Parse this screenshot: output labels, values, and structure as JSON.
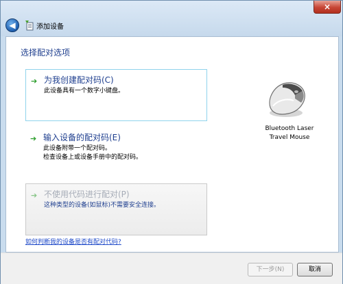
{
  "window": {
    "title": "添加设备",
    "close_label": "×"
  },
  "main": {
    "heading": "选择配对选项",
    "options": [
      {
        "title": "为我创建配对码(C)",
        "desc_lines": [
          "此设备具有一个数字小键盘。"
        ],
        "enabled": true
      },
      {
        "title": "输入设备的配对码(E)",
        "desc_lines": [
          "此设备附带一个配对码。",
          "检查设备上或设备手册中的配对码。"
        ],
        "enabled": true
      },
      {
        "title": "不使用代码进行配对(P)",
        "desc_lines": [
          "这种类型的设备(如鼠标)不需要安全连接。"
        ],
        "enabled": false
      }
    ],
    "device": {
      "name_line1": "Bluetooth Laser",
      "name_line2": "Travel Mouse",
      "icon": "mouse-icon"
    },
    "help_link": "如何判断我的设备是否有配对代码?"
  },
  "footer": {
    "next_label": "下一步(N)",
    "cancel_label": "取消"
  },
  "colors": {
    "accent_blue": "#1f3f8f",
    "link_blue": "#1d48c8",
    "arrow_green": "#2b9d2b"
  }
}
